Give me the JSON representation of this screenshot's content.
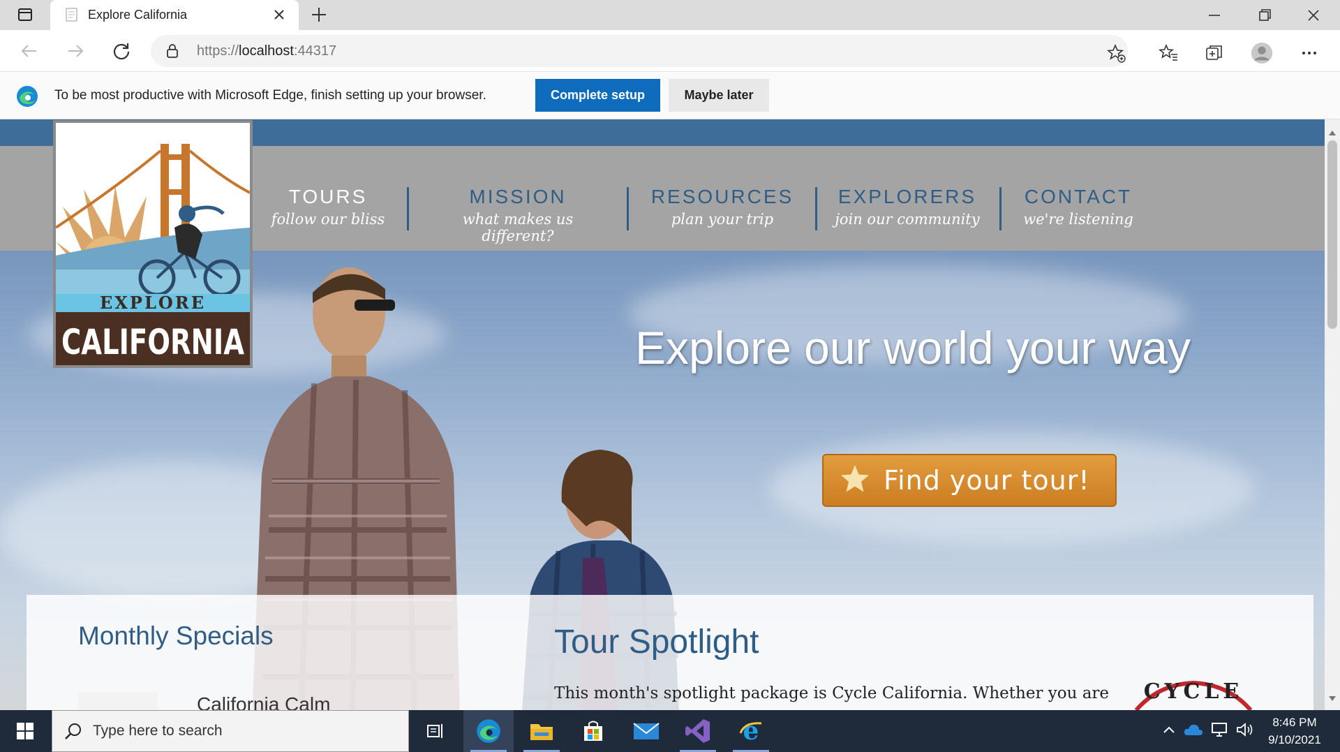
{
  "browser": {
    "tab_title": "Explore California",
    "url_scheme": "https://",
    "url_host": "localhost",
    "url_port": ":44317"
  },
  "infobar": {
    "message": "To be most productive with Microsoft Edge, finish setting up your browser.",
    "primary_button": "Complete setup",
    "secondary_button": "Maybe later"
  },
  "site": {
    "logo_top": "EXPLORE",
    "logo_bottom": "CALIFORNIA",
    "nav": [
      {
        "label": "TOURS",
        "tagline": "follow our bliss"
      },
      {
        "label": "MISSION",
        "tagline": "what makes us different?"
      },
      {
        "label": "RESOURCES",
        "tagline": "plan your trip"
      },
      {
        "label": "EXPLORERS",
        "tagline": "join our community"
      },
      {
        "label": "CONTACT",
        "tagline": "we're listening"
      }
    ],
    "headline": "Explore our world your way",
    "cta": "Find your tour!",
    "monthly_heading": "Monthly Specials",
    "monthly_item": "California Calm",
    "spotlight_heading": "Tour Spotlight",
    "spotlight_text": "This month's spotlight package is Cycle California. Whether you are"
  },
  "taskbar": {
    "search_placeholder": "Type here to search",
    "time": "8:46 PM",
    "date": "9/10/2021"
  },
  "colors": {
    "accent": "#0f6cbd",
    "brand_blue": "#2f5d86",
    "cta_orange": "#d88a2c"
  }
}
